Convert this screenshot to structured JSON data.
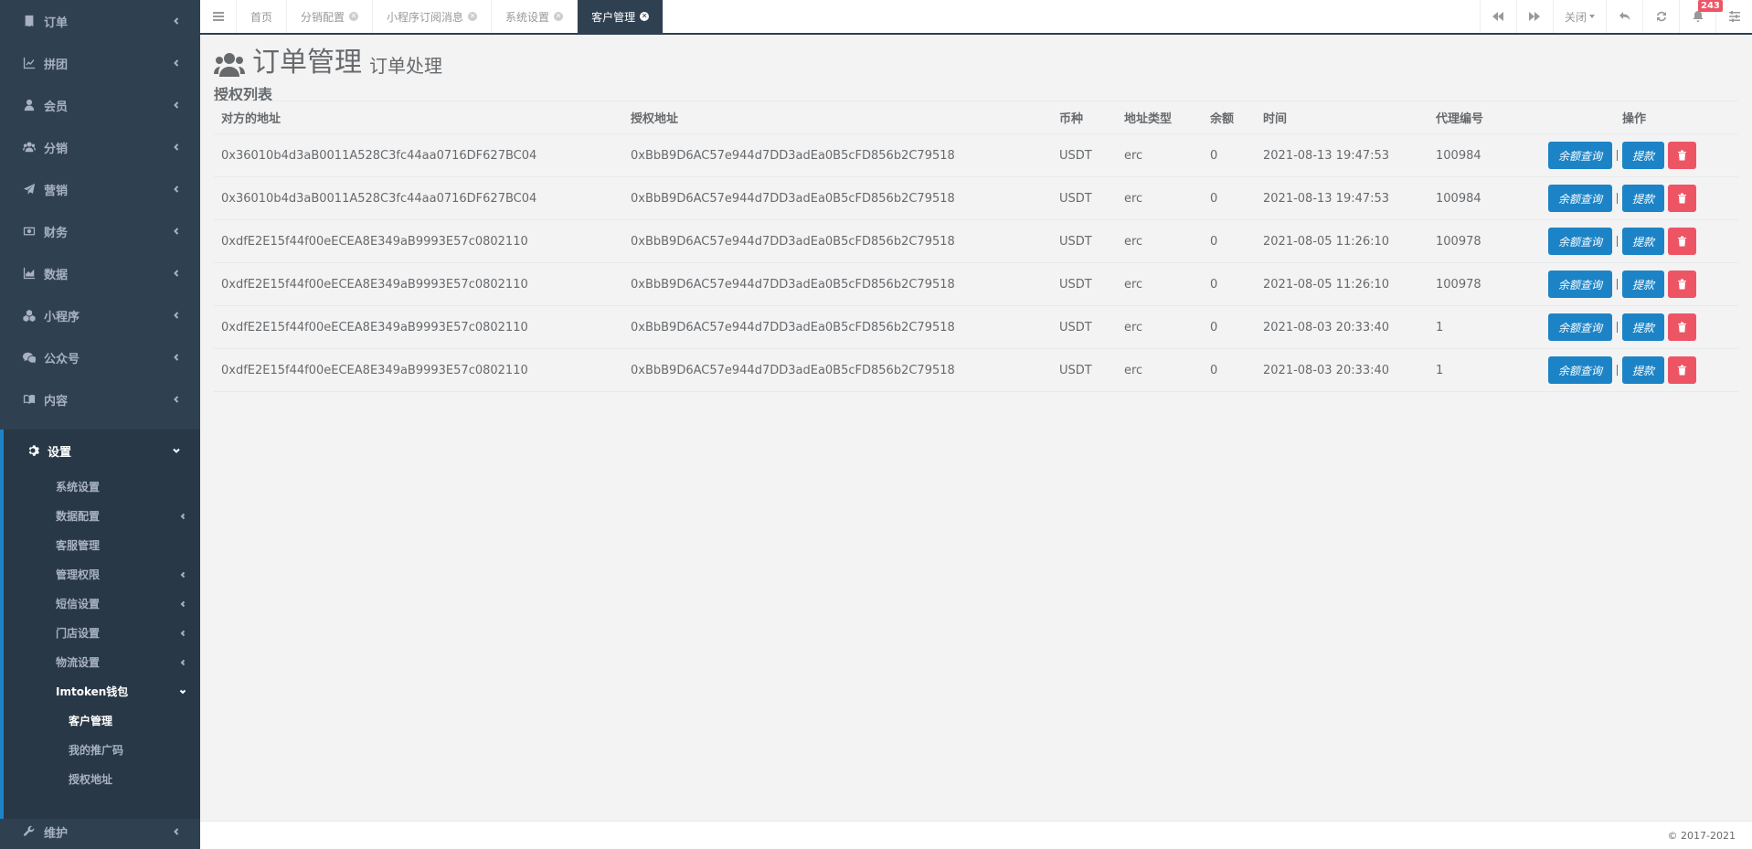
{
  "sidebar": {
    "items": [
      {
        "label": "订单",
        "icon": "receipt-icon"
      },
      {
        "label": "拼团",
        "icon": "chart-line-icon"
      },
      {
        "label": "会员",
        "icon": "user-icon"
      },
      {
        "label": "分销",
        "icon": "users-icon"
      },
      {
        "label": "营销",
        "icon": "paper-plane-icon"
      },
      {
        "label": "财务",
        "icon": "money-icon"
      },
      {
        "label": "数据",
        "icon": "area-chart-icon"
      },
      {
        "label": "小程序",
        "icon": "cubes-icon"
      },
      {
        "label": "公众号",
        "icon": "wechat-icon"
      },
      {
        "label": "内容",
        "icon": "book-icon"
      }
    ],
    "settings": {
      "label": "设置",
      "icon": "gear-icon",
      "children": [
        {
          "label": "系统设置"
        },
        {
          "label": "数据配置"
        },
        {
          "label": "客服管理"
        },
        {
          "label": "管理权限"
        },
        {
          "label": "短信设置"
        },
        {
          "label": "门店设置"
        },
        {
          "label": "物流设置"
        },
        {
          "label": "Imtoken钱包"
        }
      ],
      "wallet_children": [
        {
          "label": "客户管理"
        },
        {
          "label": "我的推广码"
        },
        {
          "label": "授权地址"
        }
      ]
    },
    "bottom": {
      "label": "维护",
      "icon": "wrench-icon"
    }
  },
  "tabs": [
    {
      "label": "首页"
    },
    {
      "label": "分销配置"
    },
    {
      "label": "小程序订阅消息"
    },
    {
      "label": "系统设置"
    },
    {
      "label": "客户管理"
    }
  ],
  "toolbar": {
    "close_label": "关闭",
    "notification_count": "243"
  },
  "page": {
    "title": "订单管理",
    "subtitle": "订单处理",
    "section_title": "授权列表"
  },
  "table": {
    "columns": [
      "对方的地址",
      "授权地址",
      "币种",
      "地址类型",
      "余额",
      "时间",
      "代理编号",
      "操作"
    ],
    "rows": [
      {
        "from": "0x36010b4d3aB0011A528C3fc44aa0716DF627BC04",
        "auth": "0xBbB9D6AC57e944d7DD3adEa0B5cFD856b2C79518",
        "coin": "USDT",
        "type": "erc",
        "balance": "0",
        "time": "2021-08-13 19:47:53",
        "agent": "100984"
      },
      {
        "from": "0x36010b4d3aB0011A528C3fc44aa0716DF627BC04",
        "auth": "0xBbB9D6AC57e944d7DD3adEa0B5cFD856b2C79518",
        "coin": "USDT",
        "type": "erc",
        "balance": "0",
        "time": "2021-08-13 19:47:53",
        "agent": "100984"
      },
      {
        "from": "0xdfE2E15f44f00eECEA8E349aB9993E57c0802110",
        "auth": "0xBbB9D6AC57e944d7DD3adEa0B5cFD856b2C79518",
        "coin": "USDT",
        "type": "erc",
        "balance": "0",
        "time": "2021-08-05 11:26:10",
        "agent": "100978"
      },
      {
        "from": "0xdfE2E15f44f00eECEA8E349aB9993E57c0802110",
        "auth": "0xBbB9D6AC57e944d7DD3adEa0B5cFD856b2C79518",
        "coin": "USDT",
        "type": "erc",
        "balance": "0",
        "time": "2021-08-05 11:26:10",
        "agent": "100978"
      },
      {
        "from": "0xdfE2E15f44f00eECEA8E349aB9993E57c0802110",
        "auth": "0xBbB9D6AC57e944d7DD3adEa0B5cFD856b2C79518",
        "coin": "USDT",
        "type": "erc",
        "balance": "0",
        "time": "2021-08-03 20:33:40",
        "agent": "1"
      },
      {
        "from": "0xdfE2E15f44f00eECEA8E349aB9993E57c0802110",
        "auth": "0xBbB9D6AC57e944d7DD3adEa0B5cFD856b2C79518",
        "coin": "USDT",
        "type": "erc",
        "balance": "0",
        "time": "2021-08-03 20:33:40",
        "agent": "1"
      }
    ],
    "actions": {
      "query_label": "余额查询",
      "withdraw_label": "提款"
    }
  },
  "footer": {
    "copyright": "© 2017-2021"
  },
  "colors": {
    "sidebar_bg": "#2f4050",
    "primary": "#1c84c6",
    "danger": "#ed5565"
  }
}
